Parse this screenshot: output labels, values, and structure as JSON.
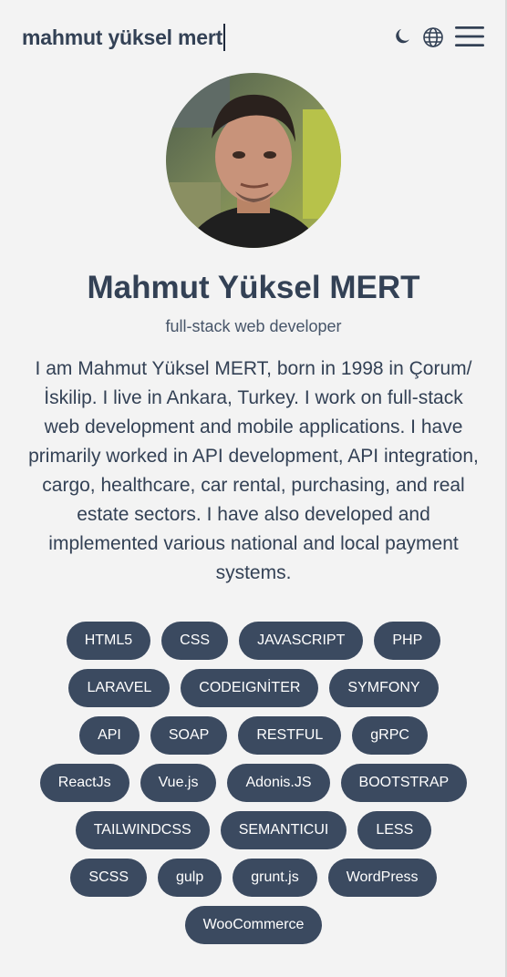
{
  "header": {
    "brand": "mahmut yüksel mert",
    "theme_icon": "moon-icon",
    "language_icon": "globe-icon",
    "menu_icon": "hamburger-menu-icon"
  },
  "profile": {
    "name": "Mahmut Yüksel MERT",
    "role": "full-stack web developer",
    "bio": "I am Mahmut Yüksel MERT, born in 1998 in Çorum/İskilip. I live in Ankara, Turkey. I work on full-stack web development and mobile applications. I have primarily worked in API development, API integration, cargo, healthcare, car rental, purchasing, and real estate sectors. I have also developed and implemented various national and local payment systems."
  },
  "skills": [
    "HTML5",
    "CSS",
    "JAVASCRIPT",
    "PHP",
    "LARAVEL",
    "CODEIGNİTER",
    "SYMFONY",
    "API",
    "SOAP",
    "RESTFUL",
    "gRPC",
    "ReactJs",
    "Vue.js",
    "Adonis.JS",
    "BOOTSTRAP",
    "TAILWINDCSS",
    "SEMANTICUI",
    "LESS",
    "SCSS",
    "gulp",
    "grunt.js",
    "WordPress",
    "WooCommerce"
  ],
  "colors": {
    "background": "#f3f3f3",
    "text": "#334155",
    "tag_background": "#3b4a60",
    "tag_text": "#ffffff"
  }
}
